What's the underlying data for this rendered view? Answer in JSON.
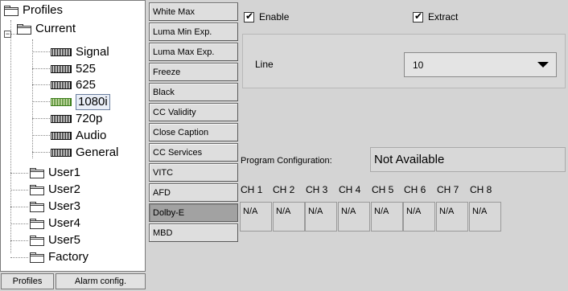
{
  "tree": {
    "root": "Profiles",
    "current": "Current",
    "current_children": [
      "Signal",
      "525",
      "625",
      "1080i",
      "720p",
      "Audio",
      "General"
    ],
    "selected": "1080i",
    "users": [
      "User1",
      "User2",
      "User3",
      "User4",
      "User5",
      "Factory"
    ]
  },
  "bottom_buttons": {
    "profiles": "Profiles",
    "alarm_config": "Alarm config."
  },
  "categories": [
    "White Max",
    "Luma Min Exp.",
    "Luma Max Exp.",
    "Freeze",
    "Black",
    "CC Validity",
    "Close Caption",
    "CC Services",
    "VITC",
    "AFD",
    "Dolby-E",
    "MBD"
  ],
  "active_category": "Dolby-E",
  "enable": {
    "label": "Enable",
    "checked": true
  },
  "extract": {
    "label": "Extract",
    "checked": true
  },
  "line": {
    "label": "Line",
    "value": "10"
  },
  "program_config": {
    "label": "Program Configuration:",
    "value": "Not Available"
  },
  "channels": {
    "headers": [
      "CH 1",
      "CH 2",
      "CH 3",
      "CH 4",
      "CH 5",
      "CH 6",
      "CH 7",
      "CH 8"
    ],
    "values": [
      "N/A",
      "N/A",
      "N/A",
      "N/A",
      "N/A",
      "N/A",
      "N/A",
      "N/A"
    ]
  }
}
